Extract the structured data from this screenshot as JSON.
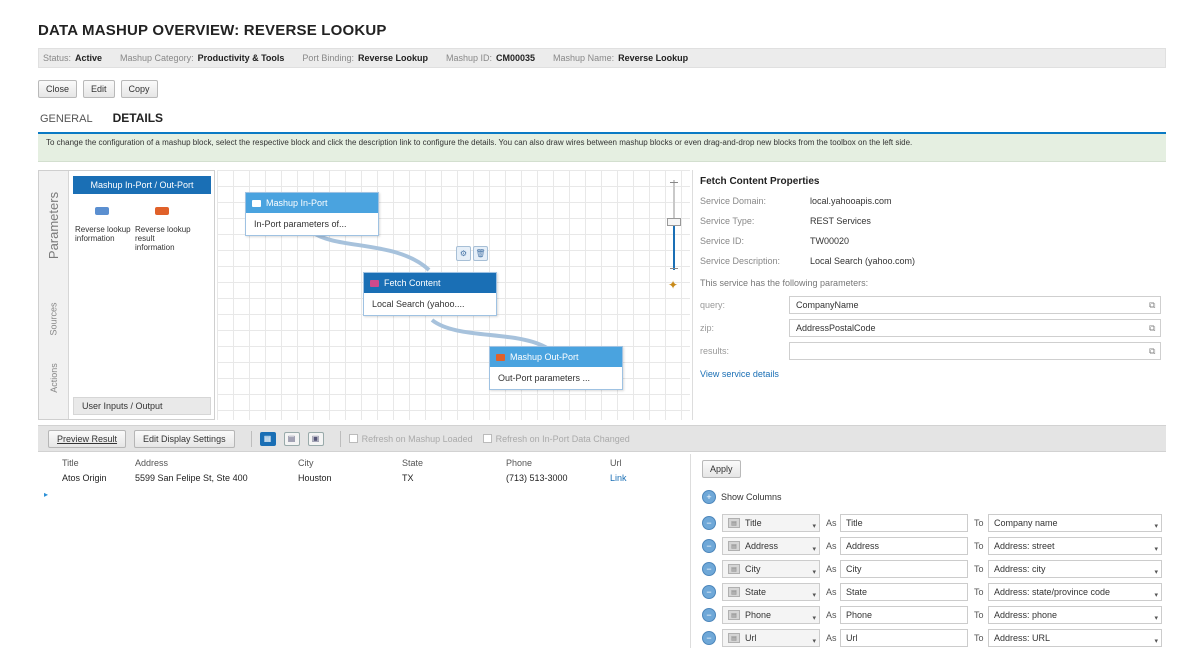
{
  "page": {
    "title": "DATA MASHUP OVERVIEW: REVERSE LOOKUP"
  },
  "status_bar": {
    "status_label": "Status:",
    "status_value": "Active",
    "category_label": "Mashup Category:",
    "category_value": "Productivity & Tools",
    "port_label": "Port Binding:",
    "port_value": "Reverse Lookup",
    "id_label": "Mashup ID:",
    "id_value": "CM00035",
    "name_label": "Mashup Name:",
    "name_value": "Reverse Lookup"
  },
  "actions": {
    "close": "Close",
    "edit": "Edit",
    "copy": "Copy"
  },
  "tabs": {
    "general": "GENERAL",
    "details": "DETAILS"
  },
  "info_text": "To change the configuration of a mashup block, select the respective block and click the description link to configure the details. You can also draw wires between mashup blocks or even drag-and-drop new blocks from the toolbox on the left side.",
  "left_panel": {
    "vtabs": [
      "Parameters",
      "Sources",
      "Actions"
    ],
    "title": "Mashup In-Port / Out-Port",
    "items": [
      {
        "label": "Reverse lookup information",
        "icon": "in-port-icon",
        "color": "#5b8fd0"
      },
      {
        "label": "Reverse lookup result information",
        "icon": "out-port-icon",
        "color": "#e0612a"
      }
    ],
    "footer": "User Inputs / Output"
  },
  "canvas": {
    "in_port": {
      "title": "Mashup In-Port",
      "body": "In-Port parameters of..."
    },
    "fetch": {
      "title": "Fetch Content",
      "body": "Local Search (yahoo...."
    },
    "out_port": {
      "title": "Mashup Out-Port",
      "body": "Out-Port parameters ..."
    }
  },
  "properties": {
    "title": "Fetch Content Properties",
    "rows": [
      {
        "label": "Service Domain:",
        "value": "local.yahooapis.com"
      },
      {
        "label": "Service Type:",
        "value": "REST Services"
      },
      {
        "label": "Service ID:",
        "value": "TW00020"
      },
      {
        "label": "Service Description:",
        "value": "Local Search (yahoo.com)"
      }
    ],
    "note": "This service has the following parameters:",
    "params": [
      {
        "label": "query:",
        "value": "CompanyName"
      },
      {
        "label": "zip:",
        "value": "AddressPostalCode"
      },
      {
        "label": "results:",
        "value": ""
      }
    ],
    "link": "View service details"
  },
  "toolbar": {
    "preview": "Preview Result",
    "display": "Edit Display Settings",
    "refresh_loaded": "Refresh on Mashup Loaded",
    "refresh_changed": "Refresh on In-Port Data Changed"
  },
  "results": {
    "columns": [
      "Title",
      "Address",
      "City",
      "State",
      "Phone",
      "Url"
    ],
    "rows": [
      {
        "title": "Atos Origin",
        "address": "5599 San Felipe St, Ste 400",
        "city": "Houston",
        "state": "TX",
        "phone": "(713) 513-3000",
        "url": "Link"
      }
    ]
  },
  "mapping": {
    "apply": "Apply",
    "show_columns": "Show Columns",
    "as_label": "As",
    "to_label": "To",
    "rows": [
      {
        "field": "Title",
        "as": "Title",
        "to": "Company name"
      },
      {
        "field": "Address",
        "as": "Address",
        "to": "Address: street"
      },
      {
        "field": "City",
        "as": "City",
        "to": "Address: city"
      },
      {
        "field": "State",
        "as": "State",
        "to": "Address: state/province code"
      },
      {
        "field": "Phone",
        "as": "Phone",
        "to": "Address: phone"
      },
      {
        "field": "Url",
        "as": "Url",
        "to": "Address: URL"
      }
    ]
  },
  "colors": {
    "accent": "#1a6fb5",
    "node_header": "#4aa3df",
    "fetch_header": "#1a6fb5",
    "info_bg": "#e5efe1"
  }
}
